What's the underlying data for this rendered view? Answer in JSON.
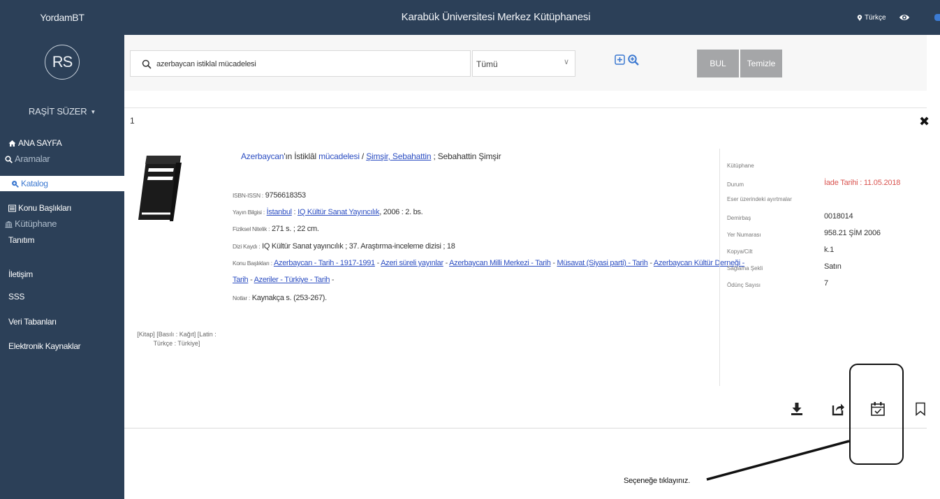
{
  "topbar": {
    "brand": "YordamBT",
    "title": "Karabük Üniversitesi Merkez Kütüphanesi",
    "language": "Türkçe"
  },
  "sidebar": {
    "avatar_initials": "RS",
    "user_name": "RAŞİT SÜZER",
    "items": [
      {
        "label": "ANA SAYFA",
        "icon": "home-icon"
      },
      {
        "label": "Aramalar",
        "icon": "search-icon"
      },
      {
        "label": "Katalog",
        "icon": "zoom-icon"
      },
      {
        "label": "Konu Başlıkları",
        "icon": "list-icon"
      },
      {
        "label": "Kütüphane",
        "icon": "library-icon"
      },
      {
        "label": "Tanıtım"
      },
      {
        "label": "İletişim"
      },
      {
        "label": "SSS"
      },
      {
        "label": "Veri Tabanları"
      },
      {
        "label": "Elektronik Kaynaklar"
      }
    ]
  },
  "search": {
    "query": "azerbaycan istiklal mücadelesi",
    "scope": "Tümü",
    "find_label": "BUL",
    "clear_label": "Temizle"
  },
  "result": {
    "count": "1",
    "title_prefix_link": "Azerbaycan",
    "title_mid": "'ın İstiklâl ",
    "title_link2": "mücadelesi",
    "title_slash": " / ",
    "author_link": "Şimşir, Sebahattin",
    "title_suffix": " ; Sebahattin Şimşir",
    "isbn_label": "ISBN-ISSN :",
    "isbn": "9756618353",
    "pub_label": "Yayın Bilgisi :",
    "pub_place": "İstanbul",
    "pub_publisher": "IQ Kültür Sanat Yayıncılık",
    "pub_rest": ", 2006 : 2. bs.",
    "phys_label": "Fiziksel Nitelik :",
    "phys": "271 s. ; 22 cm.",
    "series_label": "Dizi Kaydı :",
    "series": "IQ Kültür Sanat yayıncılık ; 37. Araştırma-inceleme dizisi ; 18",
    "subjects_label": "Konu Başlıkları :",
    "subjects": [
      "Azerbaycan - Tarih - 1917-1991",
      "Azeri süreli yayınlar",
      "Azerbaycan Milli Merkezi - Tarih",
      "Müsavat (Siyasi parti) - Tarih",
      "Azerbaycan Kültür Derneği -"
    ],
    "subjects_line2": [
      "Tarih",
      "Azeriler - Türkiye - Tarih"
    ],
    "notes_label": "Notlar :",
    "notes": "Kaynakça s. (253-267).",
    "material_line1": "[Kitap] [Basılı : Kağıt] [Latin :",
    "material_line2": "Türkçe : Türkiye]"
  },
  "holdings": {
    "rows": [
      {
        "label": "Kütüphane",
        "value": ""
      },
      {
        "label": "Durum",
        "value": "İade Tarihi : 11.05.2018"
      },
      {
        "label": "Eser üzerindeki ayırtmalar",
        "value": ""
      },
      {
        "label": "Demirbaş",
        "value": "0018014"
      },
      {
        "label": "Yer Numarası",
        "value": "958.21 ŞİM 2006"
      },
      {
        "label": "Kopya/Cilt",
        "value": "k.1"
      },
      {
        "label": "Sağlama Şekli",
        "value": "Satın"
      },
      {
        "label": "Ödünç Sayısı",
        "value": "7"
      }
    ]
  },
  "actions": [
    "download-icon",
    "share-icon",
    "calendar-check-icon",
    "bookmark-icon"
  ],
  "annotation": {
    "note": "Seçeneğe tıklayınız."
  },
  "colors": {
    "sidebar_bg": "#2c4058",
    "link": "#2c4ec2",
    "active_nav": "#3c79d1",
    "due_red": "#d9534f",
    "button_grey": "#a5a6a8"
  }
}
